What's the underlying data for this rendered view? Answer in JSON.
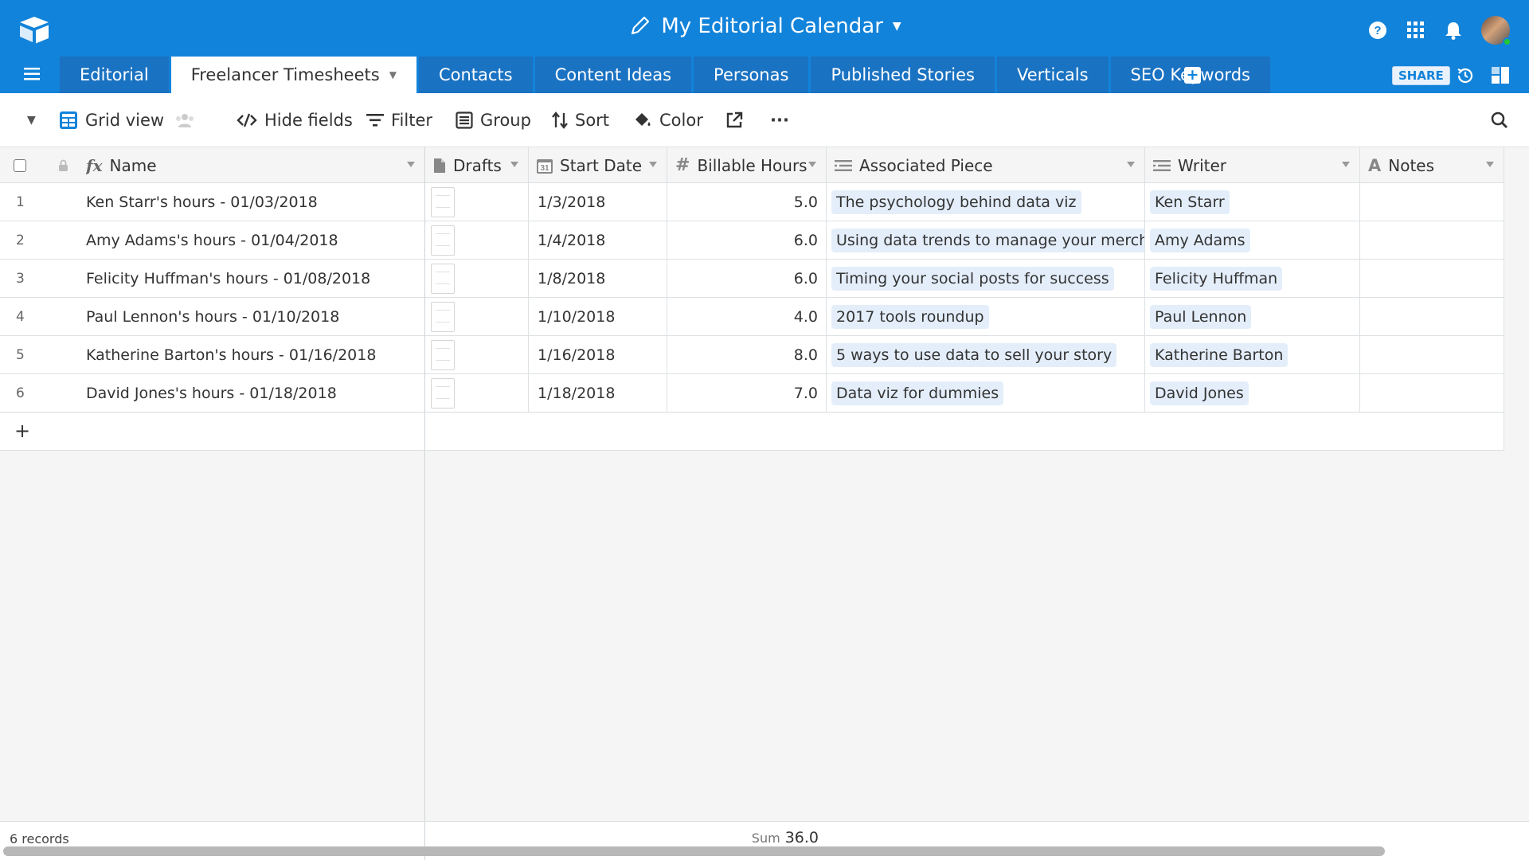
{
  "app": {
    "base_title": "My Editorial Calendar"
  },
  "tabs": [
    {
      "label": "Editorial",
      "active": false
    },
    {
      "label": "Freelancer Timesheets",
      "active": true
    },
    {
      "label": "Contacts",
      "active": false
    },
    {
      "label": "Content Ideas",
      "active": false
    },
    {
      "label": "Personas",
      "active": false
    },
    {
      "label": "Published Stories",
      "active": false
    },
    {
      "label": "Verticals",
      "active": false
    },
    {
      "label": "SEO Keywords",
      "active": false
    }
  ],
  "header_actions": {
    "share_label": "SHARE"
  },
  "toolbar": {
    "view_name": "Grid view",
    "hide_fields": "Hide fields",
    "filter": "Filter",
    "group": "Group",
    "sort": "Sort",
    "color": "Color",
    "more": "···"
  },
  "columns": [
    {
      "label": "Name",
      "icon": "formula-icon"
    },
    {
      "label": "Drafts",
      "icon": "attachment-icon"
    },
    {
      "label": "Start Date",
      "icon": "calendar-icon"
    },
    {
      "label": "Billable Hours",
      "icon": "number-icon"
    },
    {
      "label": "Associated Piece",
      "icon": "link-icon"
    },
    {
      "label": "Writer",
      "icon": "link-icon"
    },
    {
      "label": "Notes",
      "icon": "text-icon"
    }
  ],
  "rows": [
    {
      "num": "1",
      "name": "Ken Starr's hours - 01/03/2018",
      "start_date": "1/3/2018",
      "hours": "5.0",
      "piece": "The psychology behind data viz",
      "writer": "Ken Starr",
      "notes": ""
    },
    {
      "num": "2",
      "name": "Amy Adams's hours - 01/04/2018",
      "start_date": "1/4/2018",
      "hours": "6.0",
      "piece": "Using data trends to manage your merchandise",
      "writer": "Amy Adams",
      "notes": ""
    },
    {
      "num": "3",
      "name": "Felicity Huffman's hours - 01/08/2018",
      "start_date": "1/8/2018",
      "hours": "6.0",
      "piece": "Timing your social posts for success",
      "writer": "Felicity Huffman",
      "notes": ""
    },
    {
      "num": "4",
      "name": "Paul Lennon's hours - 01/10/2018",
      "start_date": "1/10/2018",
      "hours": "4.0",
      "piece": "2017 tools roundup",
      "writer": "Paul Lennon",
      "notes": ""
    },
    {
      "num": "5",
      "name": "Katherine Barton's hours - 01/16/2018",
      "start_date": "1/16/2018",
      "hours": "8.0",
      "piece": "5 ways to use data to sell your story",
      "writer": "Katherine Barton",
      "notes": ""
    },
    {
      "num": "6",
      "name": "David Jones's hours - 01/18/2018",
      "start_date": "1/18/2018",
      "hours": "7.0",
      "piece": "Data viz for dummies",
      "writer": "David Jones",
      "notes": ""
    }
  ],
  "footer": {
    "record_count": "6 records",
    "sum_label": "Sum",
    "sum_value": "36.0"
  },
  "colors": {
    "header_blue": "#1283da",
    "inactive_tab": "#1a72c2",
    "chip_bg": "#e4eefa"
  }
}
